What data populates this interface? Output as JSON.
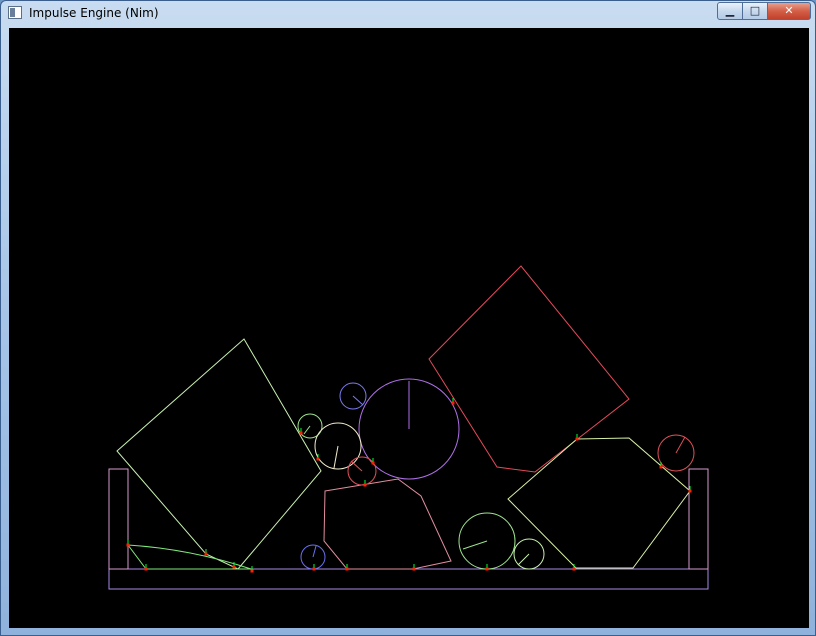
{
  "window": {
    "title": "Impulse Engine (Nim)",
    "controls": {
      "minimize": "▁",
      "maximize": "□",
      "close": "✕"
    }
  },
  "colors": {
    "canvas_background": "#000000",
    "contact_point": "#ff2000",
    "contact_normal": "#00ff30"
  },
  "scene": {
    "bodies": [
      "ground-box",
      "left-wall",
      "right-wall",
      "circles",
      "polygons"
    ]
  }
}
